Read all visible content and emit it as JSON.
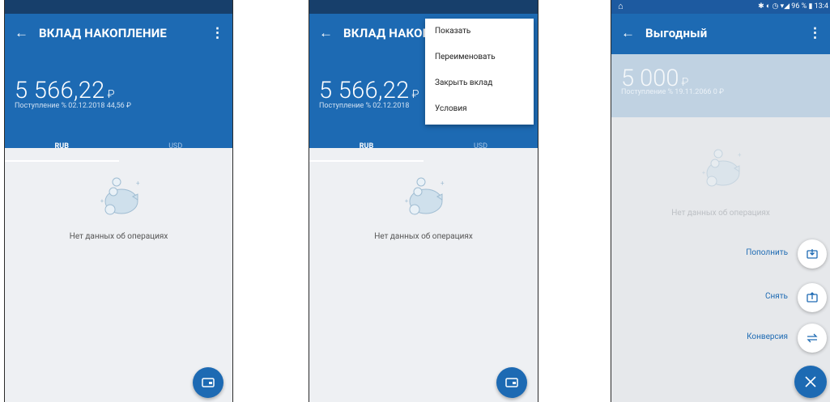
{
  "screens": [
    {
      "title": "ВКЛАД НАКОПЛЕНИЕ",
      "balance": "5 566,22",
      "currency_symbol": "₽",
      "income_line": "Поступление % 02.12.2018  44,56 ₽",
      "tabs": [
        "RUB",
        "USD"
      ],
      "empty_text": "Нет данных об операциях"
    },
    {
      "title": "ВКЛАД НАКОП",
      "balance": "5 566,22",
      "currency_symbol": "₽",
      "income_line": "Поступление % 02.12.2018",
      "tabs": [
        "RUB",
        "USD"
      ],
      "empty_text": "Нет данных об операциях",
      "menu": [
        "Показать",
        "Переименовать",
        "Закрыть вклад",
        "Условия"
      ]
    },
    {
      "status_bar": {
        "battery": "96 %",
        "time": "13:4"
      },
      "title": "Выгодный",
      "balance": "5 000",
      "currency_symbol": "₽",
      "income_line": "Поступление % 19.11.2066 0 ₽",
      "empty_text": "Нет данных об операциях",
      "actions": [
        "Пополнить",
        "Снять",
        "Конверсия"
      ]
    }
  ],
  "colors": {
    "primary": "#1d6ab3",
    "status_bar": "#173f6b",
    "background": "#eef0f3"
  },
  "icons": {
    "back": "arrow-left-icon",
    "overflow": "more-vertical-icon",
    "fab": "wallet-icon",
    "empty": "piggy-bank-icon",
    "deposit": "deposit-icon",
    "withdraw": "withdraw-icon",
    "convert": "exchange-icon",
    "close": "close-icon"
  }
}
